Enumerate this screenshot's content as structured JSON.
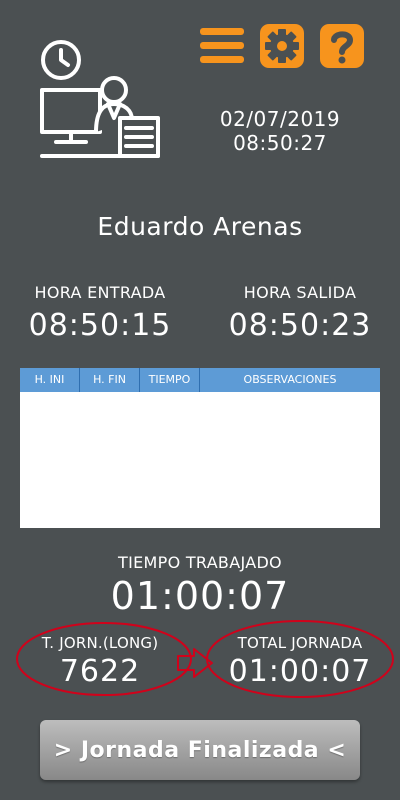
{
  "header": {
    "icons": {
      "worker": "worker-clock-icon",
      "menu": "hamburger-menu-icon",
      "settings": "gear-icon",
      "help": "help-question-icon"
    },
    "date": "02/07/2019",
    "time": "08:50:27"
  },
  "user": {
    "name": "Eduardo Arenas"
  },
  "entry": {
    "label": "HORA ENTRADA",
    "value": "08:50:15"
  },
  "exit": {
    "label": "HORA SALIDA",
    "value": "08:50:23"
  },
  "table": {
    "columns": [
      "H. INI",
      "H. FIN",
      "TIEMPO",
      "OBSERVACIONES"
    ],
    "rows": []
  },
  "worked": {
    "label": "TIEMPO TRABAJADO",
    "value": "01:00:07"
  },
  "shift_long": {
    "label": "T. JORN.(LONG)",
    "value": "7622"
  },
  "shift_total": {
    "label": "TOTAL JORNADA",
    "value": "01:00:07"
  },
  "finish_button": {
    "label": "> Jornada Finalizada <"
  },
  "colors": {
    "background": "#4b5052",
    "accent": "#f7941d",
    "table_header": "#5d9bd6",
    "annotation": "#d0021b"
  }
}
